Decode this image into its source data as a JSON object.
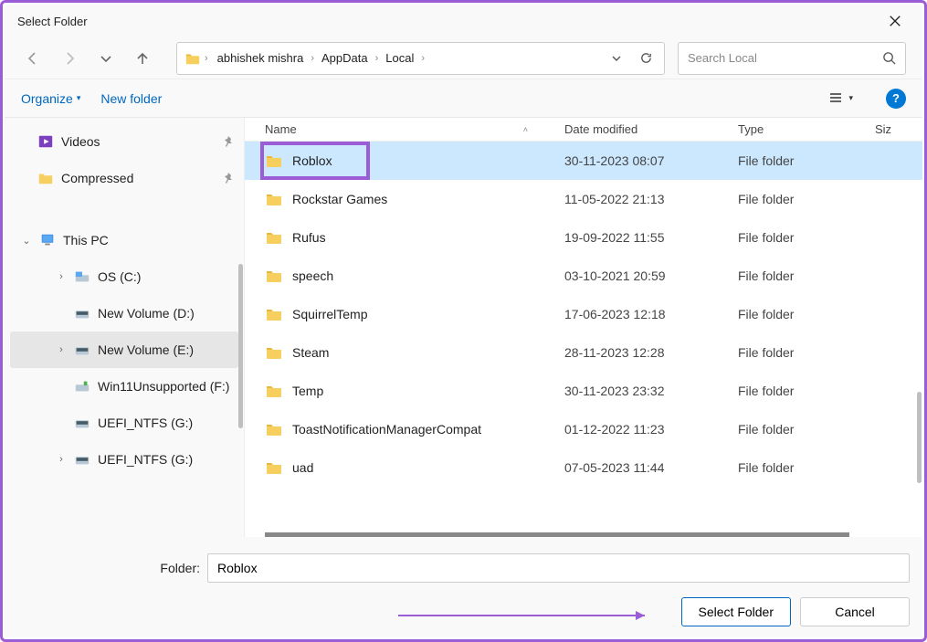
{
  "window": {
    "title": "Select Folder"
  },
  "breadcrumb": {
    "items": [
      "abhishek mishra",
      "AppData",
      "Local"
    ]
  },
  "search": {
    "placeholder": "Search Local"
  },
  "toolbar": {
    "organize": "Organize",
    "newFolder": "New folder"
  },
  "sidebar": {
    "items": [
      {
        "label": "Videos",
        "icon": "videos",
        "indent": "indent1",
        "pin": true
      },
      {
        "label": "Compressed",
        "icon": "folder",
        "indent": "indent1",
        "pin": true
      },
      {
        "label": "This PC",
        "icon": "pc",
        "indent": "root",
        "expand": "v"
      },
      {
        "label": "OS (C:)",
        "icon": "drive-c",
        "indent": "indent2",
        "expand": ">"
      },
      {
        "label": "New Volume (D:)",
        "icon": "drive",
        "indent": "indent2"
      },
      {
        "label": "New Volume (E:)",
        "icon": "drive",
        "indent": "indent2",
        "active": true,
        "expand": ">"
      },
      {
        "label": "Win11Unsupported (F:)",
        "icon": "drive-usb",
        "indent": "indent2"
      },
      {
        "label": "UEFI_NTFS (G:)",
        "icon": "drive",
        "indent": "indent2"
      },
      {
        "label": "UEFI_NTFS (G:)",
        "icon": "drive",
        "indent": "indent2",
        "expand": ">"
      }
    ]
  },
  "columns": {
    "name": "Name",
    "date": "Date modified",
    "type": "Type",
    "size": "Siz"
  },
  "files": [
    {
      "name": "Roblox",
      "date": "30-11-2023 08:07",
      "type": "File folder",
      "selected": true,
      "highlighted": true
    },
    {
      "name": "Rockstar Games",
      "date": "11-05-2022 21:13",
      "type": "File folder"
    },
    {
      "name": "Rufus",
      "date": "19-09-2022 11:55",
      "type": "File folder"
    },
    {
      "name": "speech",
      "date": "03-10-2021 20:59",
      "type": "File folder"
    },
    {
      "name": "SquirrelTemp",
      "date": "17-06-2023 12:18",
      "type": "File folder"
    },
    {
      "name": "Steam",
      "date": "28-11-2023 12:28",
      "type": "File folder"
    },
    {
      "name": "Temp",
      "date": "30-11-2023 23:32",
      "type": "File folder"
    },
    {
      "name": "ToastNotificationManagerCompat",
      "date": "01-12-2022 11:23",
      "type": "File folder"
    },
    {
      "name": "uad",
      "date": "07-05-2023 11:44",
      "type": "File folder"
    }
  ],
  "footer": {
    "folderLabel": "Folder:",
    "folderValue": "Roblox",
    "selectBtn": "Select Folder",
    "cancelBtn": "Cancel"
  }
}
